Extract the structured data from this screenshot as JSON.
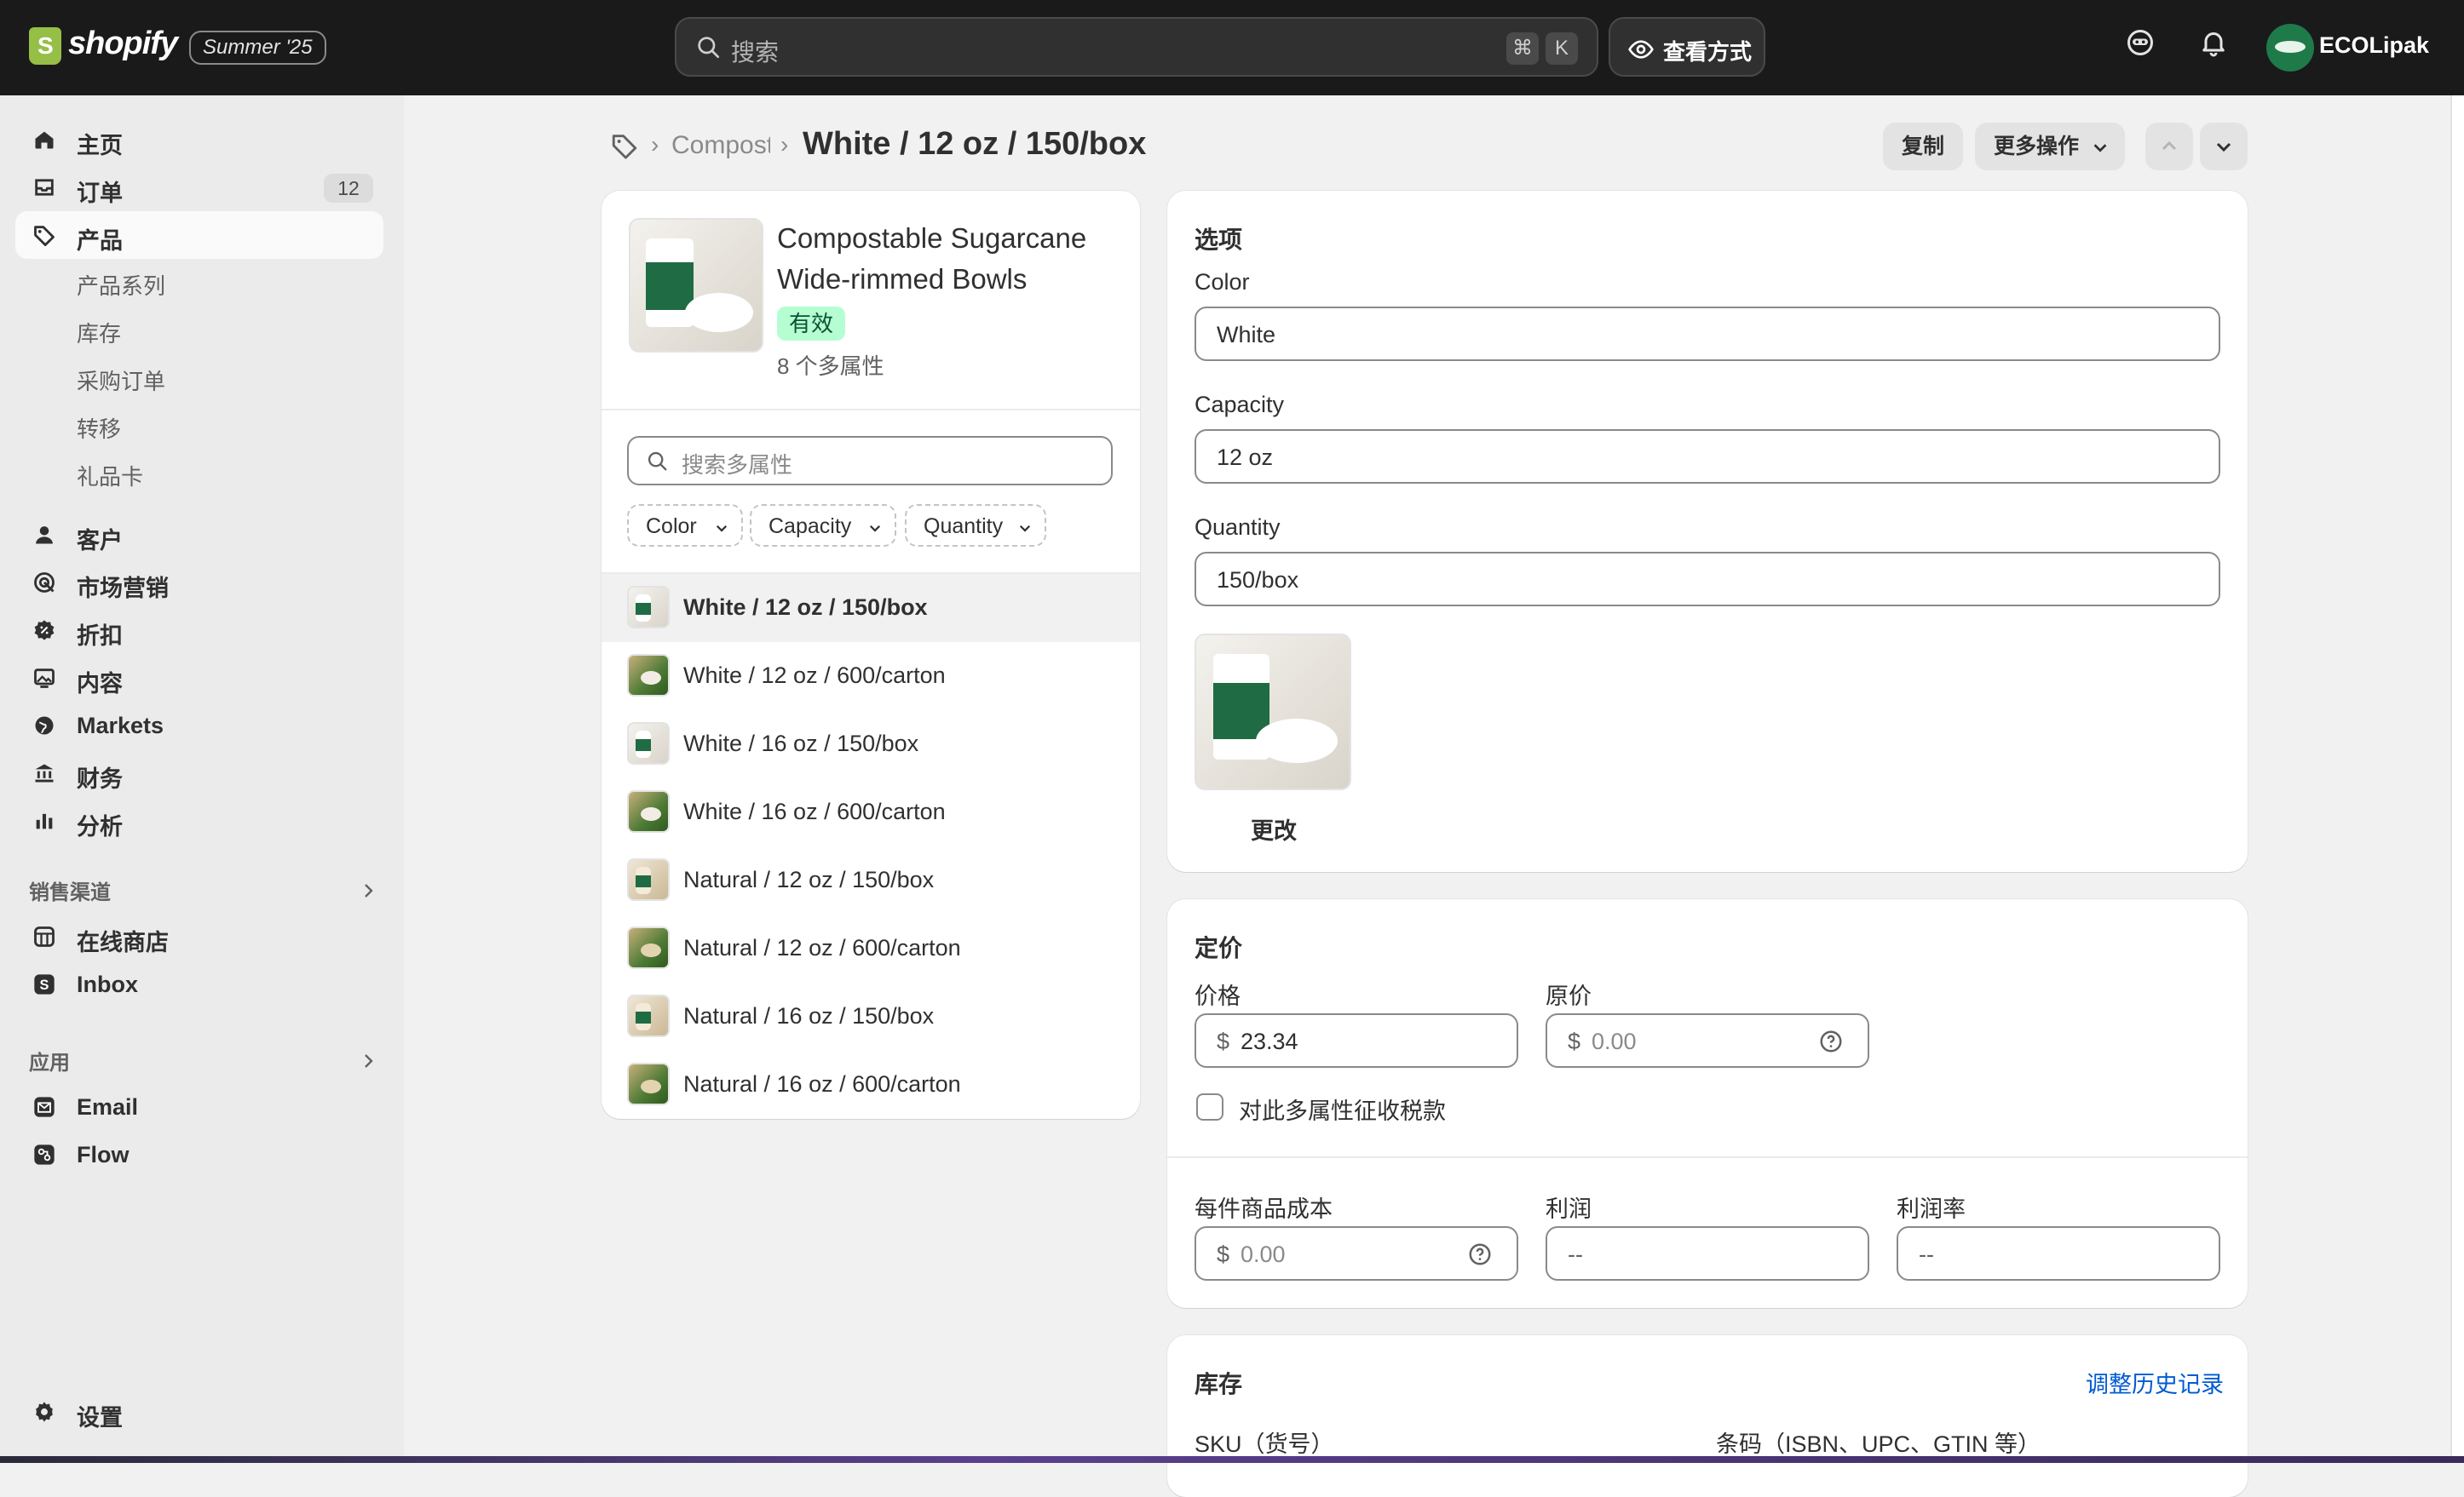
{
  "topbar": {
    "brand": "shopify",
    "edition_badge": "Summer '25",
    "search_placeholder": "搜索",
    "shortcut_cmd": "⌘",
    "shortcut_key": "K",
    "view_button": "查看方式",
    "store_name": "ECOLipak"
  },
  "sidebar": {
    "items": [
      {
        "label": "主页"
      },
      {
        "label": "订单",
        "count": "12"
      },
      {
        "label": "产品"
      }
    ],
    "product_sub": [
      "产品系列",
      "库存",
      "采购订单",
      "转移",
      "礼品卡"
    ],
    "items2": [
      {
        "label": "客户"
      },
      {
        "label": "市场营销"
      },
      {
        "label": "折扣"
      },
      {
        "label": "内容"
      },
      {
        "label": "Markets"
      },
      {
        "label": "财务"
      },
      {
        "label": "分析"
      }
    ],
    "sales_channels_title": "销售渠道",
    "channels": [
      {
        "label": "在线商店"
      },
      {
        "label": "Inbox"
      }
    ],
    "apps_title": "应用",
    "apps": [
      {
        "label": "Email"
      },
      {
        "label": "Flow"
      }
    ],
    "settings": "设置"
  },
  "header": {
    "breadcrumb_parent": "Compostable Sugarcane Wide-rimmed Bowls",
    "title": "White / 12 oz / 150/box",
    "duplicate": "复制",
    "more_actions": "更多操作"
  },
  "product": {
    "title": "Compostable Sugarcane Wide-rimmed Bowls",
    "status": "有效",
    "variant_count": "8 个多属性"
  },
  "variant_list": {
    "search_placeholder": "搜索多属性",
    "filters": [
      "Color",
      "Capacity",
      "Quantity"
    ],
    "variants": [
      "White / 12 oz / 150/box",
      "White / 12 oz / 600/carton",
      "White / 16 oz / 150/box",
      "White / 16 oz / 600/carton",
      "Natural / 12 oz / 150/box",
      "Natural / 12 oz / 600/carton",
      "Natural / 16 oz / 150/box",
      "Natural / 16 oz / 600/carton"
    ]
  },
  "options_card": {
    "title": "选项",
    "fields": [
      {
        "label": "Color",
        "value": "White"
      },
      {
        "label": "Capacity",
        "value": "12 oz"
      },
      {
        "label": "Quantity",
        "value": "150/box"
      }
    ],
    "change_image": "更改"
  },
  "pricing_card": {
    "title": "定价",
    "price_label": "价格",
    "currency": "$",
    "price_value": "23.34",
    "compare_label": "原价",
    "compare_value": "0.00",
    "tax_label": "对此多属性征收税款",
    "cost_label": "每件商品成本",
    "cost_value": "0.00",
    "profit_label": "利润",
    "profit_value": "--",
    "margin_label": "利润率",
    "margin_value": "--"
  },
  "inventory_card": {
    "title": "库存",
    "history_link": "调整历史记录",
    "sku_label": "SKU（货号）",
    "barcode_label": "条码（ISBN、UPC、GTIN 等）"
  },
  "colors": {
    "topbar": "#1a1a1a",
    "active_badge_bg": "#b4fed2",
    "link": "#005bd3"
  }
}
